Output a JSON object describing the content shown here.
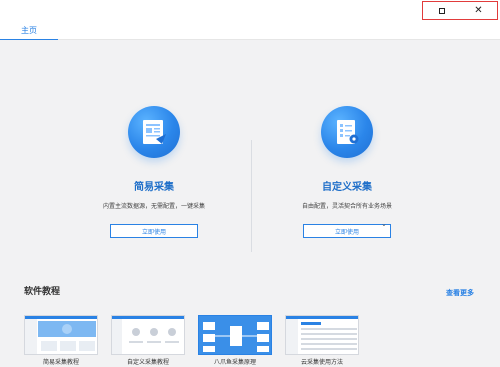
{
  "tabs": [
    {
      "label": "主页"
    }
  ],
  "cards": [
    {
      "title": "简易采集",
      "desc": "内置主流数据源，无需配置，一键采集",
      "button": "立即使用"
    },
    {
      "title": "自定义采集",
      "desc": "自由配置，灵活契合所有业务场景",
      "button": "立即使用"
    }
  ],
  "tutorials": {
    "title": "软件教程",
    "more": "查看更多",
    "items": [
      {
        "label": "简易采集教程"
      },
      {
        "label": "自定义采集教程"
      },
      {
        "label": "八爪鱼采集原理"
      },
      {
        "label": "云采集使用方法"
      }
    ]
  },
  "window": {
    "maximize_icon": "□",
    "close_icon": "✕"
  },
  "colors": {
    "accent": "#2a82e4",
    "highlight_border": "#e13b3b",
    "background": "#f2f2f3"
  }
}
